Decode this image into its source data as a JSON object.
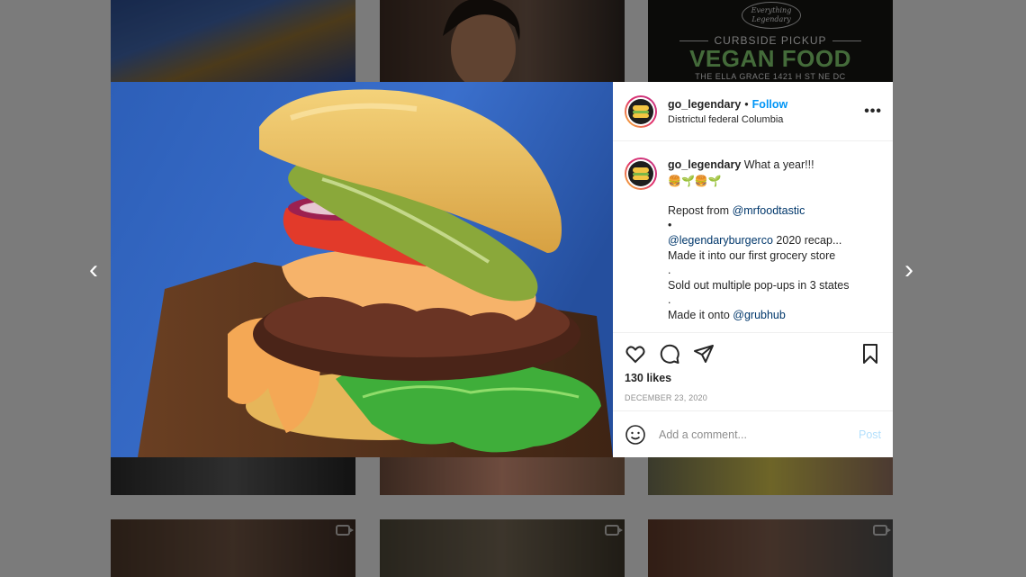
{
  "colors": {
    "follow_blue": "#0095f6",
    "mention_blue": "#00376b",
    "post_disabled": "#b2dffc",
    "vegan_green": "#7dc46a"
  },
  "grid": {
    "poster": {
      "badge_line1": "Everything",
      "badge_line2": "Legendary",
      "curbside": "CURBSIDE PICKUP",
      "headline": "VEGAN FOOD",
      "address": "THE ELLA GRACE 1421 H ST NE DC"
    }
  },
  "nav": {
    "prev_icon": "chevron-left-icon",
    "next_icon": "chevron-right-icon"
  },
  "post": {
    "username": "go_legendary",
    "separator": "•",
    "follow_label": "Follow",
    "location": "Districtul federal Columbia",
    "more_icon": "•••",
    "caption": {
      "username": "go_legendary",
      "text": " What a year!!!",
      "emoji": "🍔🌱🍔🌱",
      "repost_prefix": "Repost from ",
      "repost_mention": "@mrfoodtastic",
      "bullet1": "•",
      "mention2": "@legendaryburgerco",
      "line2_rest": " 2020 recap...",
      "line3": "Made it into our first grocery store",
      "dot1": ".",
      "line4": "Sold out multiple pop-ups in 3 states",
      "dot2": ".",
      "line5_prefix": "Made it onto ",
      "line5_mention": "@grubhub"
    },
    "likes": "130 likes",
    "date": "DECEMBER 23, 2020",
    "comment_placeholder": "Add a comment...",
    "post_label": "Post"
  }
}
